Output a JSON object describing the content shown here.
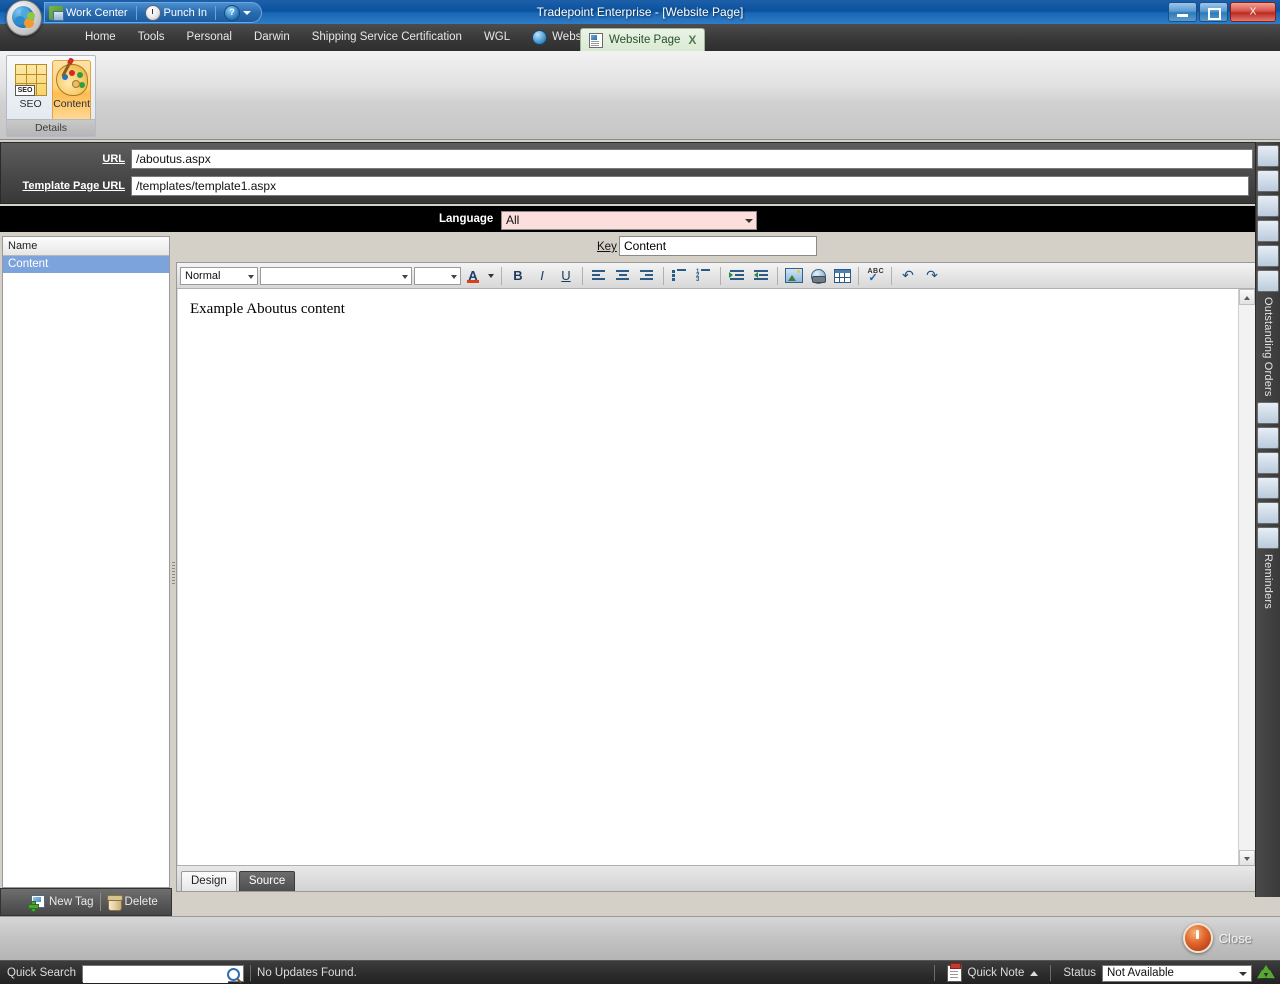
{
  "window": {
    "title": "Tradepoint Enterprise - [Website Page]",
    "minimize_label": "Minimize",
    "restore_label": "Restore",
    "close_label": "X"
  },
  "quick_toolbar": {
    "items": [
      {
        "label": "Work Center",
        "icon": "work-center-icon"
      },
      {
        "label": "Punch In",
        "icon": "clock-icon"
      },
      {
        "label": "?",
        "icon": "help-icon"
      }
    ]
  },
  "menu": {
    "items": [
      {
        "label": "Home",
        "icon": ""
      },
      {
        "label": "Tools",
        "icon": ""
      },
      {
        "label": "Personal",
        "icon": ""
      },
      {
        "label": "Darwin",
        "icon": ""
      },
      {
        "label": "Shipping Service Certification",
        "icon": ""
      },
      {
        "label": "WGL",
        "icon": ""
      },
      {
        "label": "Websites (1)",
        "icon": "globe-icon"
      }
    ]
  },
  "tabs": [
    {
      "label": "Website Page",
      "close": "X",
      "active": true
    }
  ],
  "ribbon": {
    "group_label": "Details",
    "buttons": [
      {
        "label": "SEO",
        "icon": "seo-icon",
        "active": false
      },
      {
        "label": "Content",
        "icon": "palette-icon",
        "active": true
      }
    ]
  },
  "fields": {
    "url_label": "URL",
    "url_value": "/aboutus.aspx",
    "template_label": "Template Page URL",
    "template_value": "/templates/template1.aspx"
  },
  "language": {
    "label": "Language",
    "value": "All",
    "bg_color": "#fcdfdc"
  },
  "left_panel": {
    "column_header": "Name",
    "rows": [
      {
        "label": "Content",
        "selected": true
      }
    ],
    "new_tag_label": "New Tag",
    "delete_label": "Delete"
  },
  "key_field": {
    "label": "Key",
    "value": "Content"
  },
  "editor": {
    "toolbar": {
      "style_value": "Normal",
      "font_value": "",
      "size_value": "",
      "buttons": [
        {
          "name": "font-color",
          "label": "A"
        },
        {
          "name": "bold",
          "label": "B"
        },
        {
          "name": "italic",
          "label": "I"
        },
        {
          "name": "underline",
          "label": "U"
        },
        {
          "name": "align-left",
          "label": ""
        },
        {
          "name": "align-center",
          "label": ""
        },
        {
          "name": "align-right",
          "label": ""
        },
        {
          "name": "bullet-list",
          "label": ""
        },
        {
          "name": "numbered-list",
          "label": ""
        },
        {
          "name": "indent",
          "label": ""
        },
        {
          "name": "outdent",
          "label": ""
        },
        {
          "name": "insert-image",
          "label": ""
        },
        {
          "name": "insert-link",
          "label": ""
        },
        {
          "name": "insert-table",
          "label": ""
        },
        {
          "name": "spellcheck",
          "label": "ABC"
        },
        {
          "name": "undo",
          "label": "↶"
        },
        {
          "name": "redo",
          "label": "↷"
        }
      ]
    },
    "content_text": "Example Aboutus content",
    "view_tabs": [
      {
        "label": "Design",
        "active": false
      },
      {
        "label": "Source",
        "active": true
      }
    ]
  },
  "right_sidebar": {
    "labels": [
      "Outstanding Orders",
      "Reminders"
    ]
  },
  "close_bar": {
    "close_label": "Close"
  },
  "status_bar": {
    "quick_search_label": "Quick Search",
    "quick_search_value": "",
    "quick_search_placeholder": "",
    "update_text": "No Updates Found.",
    "quick_note_label": "Quick Note",
    "status_label": "Status",
    "status_value": "Not Available"
  }
}
